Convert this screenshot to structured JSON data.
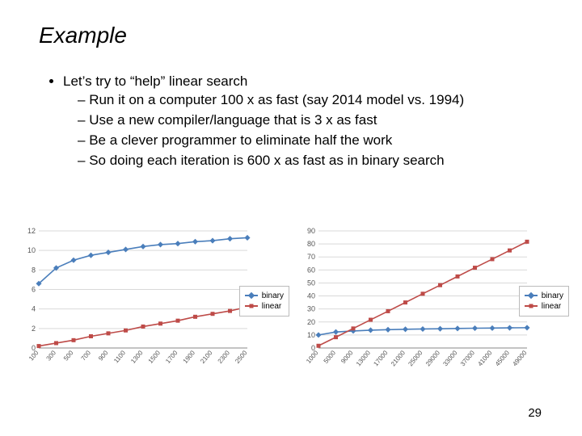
{
  "title": "Example",
  "bullet": "Let’s try to “help” linear search",
  "subs": [
    "Run it on a computer 100 x as fast (say 2014 model vs. 1994)",
    "Use a new compiler/language that is 3 x as fast",
    "Be a clever programmer to eliminate half the work",
    "So doing each iteration is 600 x as fast as in binary search"
  ],
  "page_number": "29",
  "legend": {
    "binary": "binary",
    "linear": "linear"
  },
  "chart_data": [
    {
      "type": "line",
      "title": "",
      "xlabel": "",
      "ylabel": "",
      "ylim": [
        0,
        12
      ],
      "yticks": [
        0,
        2,
        4,
        6,
        8,
        10,
        12
      ],
      "categories": [
        100,
        300,
        500,
        700,
        900,
        1100,
        1300,
        1500,
        1700,
        1900,
        2100,
        2300,
        2500
      ],
      "series": [
        {
          "name": "binary",
          "color": "#4a7ebb",
          "values": [
            6.6,
            8.2,
            9.0,
            9.5,
            9.8,
            10.1,
            10.4,
            10.6,
            10.7,
            10.9,
            11.0,
            11.2,
            11.3
          ]
        },
        {
          "name": "linear",
          "color": "#be4b48",
          "values": [
            0.2,
            0.5,
            0.8,
            1.2,
            1.5,
            1.8,
            2.2,
            2.5,
            2.8,
            3.2,
            3.5,
            3.8,
            4.2
          ]
        }
      ]
    },
    {
      "type": "line",
      "title": "",
      "xlabel": "",
      "ylabel": "",
      "ylim": [
        0,
        90
      ],
      "yticks": [
        0,
        10,
        20,
        30,
        40,
        50,
        60,
        70,
        80,
        90
      ],
      "categories": [
        1000,
        5000,
        9000,
        13000,
        17000,
        21000,
        25000,
        29000,
        33000,
        37000,
        41000,
        45000,
        49000
      ],
      "series": [
        {
          "name": "binary",
          "color": "#4a7ebb",
          "values": [
            10.0,
            12.3,
            13.1,
            13.7,
            14.1,
            14.4,
            14.6,
            14.8,
            15.0,
            15.2,
            15.3,
            15.5,
            15.6
          ]
        },
        {
          "name": "linear",
          "color": "#be4b48",
          "values": [
            1.7,
            8.3,
            15.0,
            21.7,
            28.3,
            35.0,
            41.7,
            48.3,
            55.0,
            61.7,
            68.3,
            75.0,
            81.7
          ]
        }
      ]
    }
  ]
}
